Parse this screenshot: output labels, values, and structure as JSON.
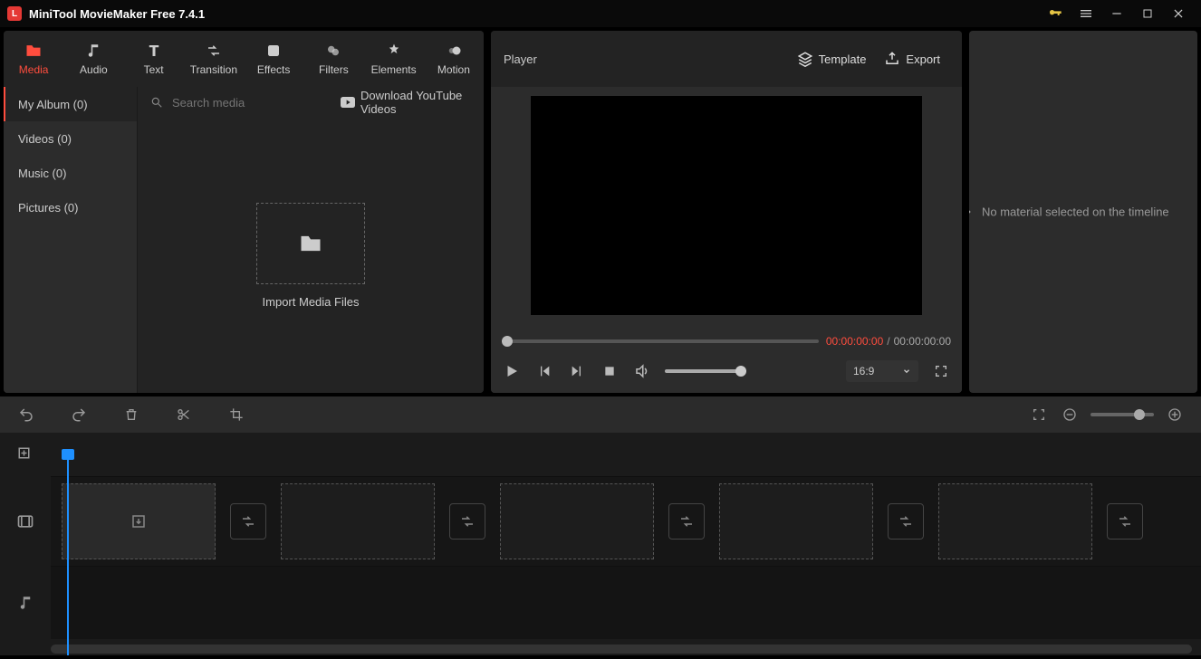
{
  "app": {
    "title": "MiniTool MovieMaker Free 7.4.1"
  },
  "maintabs": [
    {
      "label": "Media",
      "icon": "folder"
    },
    {
      "label": "Audio",
      "icon": "music"
    },
    {
      "label": "Text",
      "icon": "text"
    },
    {
      "label": "Transition",
      "icon": "transition"
    },
    {
      "label": "Effects",
      "icon": "effects"
    },
    {
      "label": "Filters",
      "icon": "filters"
    },
    {
      "label": "Elements",
      "icon": "elements"
    },
    {
      "label": "Motion",
      "icon": "motion"
    }
  ],
  "sidecats": [
    {
      "label": "My Album (0)"
    },
    {
      "label": "Videos (0)"
    },
    {
      "label": "Music (0)"
    },
    {
      "label": "Pictures (0)"
    }
  ],
  "search": {
    "placeholder": "Search media"
  },
  "youtube": {
    "label": "Download YouTube Videos"
  },
  "import": {
    "label": "Import Media Files"
  },
  "player": {
    "title": "Player",
    "template": "Template",
    "export": "Export",
    "current": "00:00:00:00",
    "total": "00:00:00:00",
    "separator": "/",
    "aspect": "16:9"
  },
  "inspector": {
    "message": "No material selected on the timeline"
  }
}
